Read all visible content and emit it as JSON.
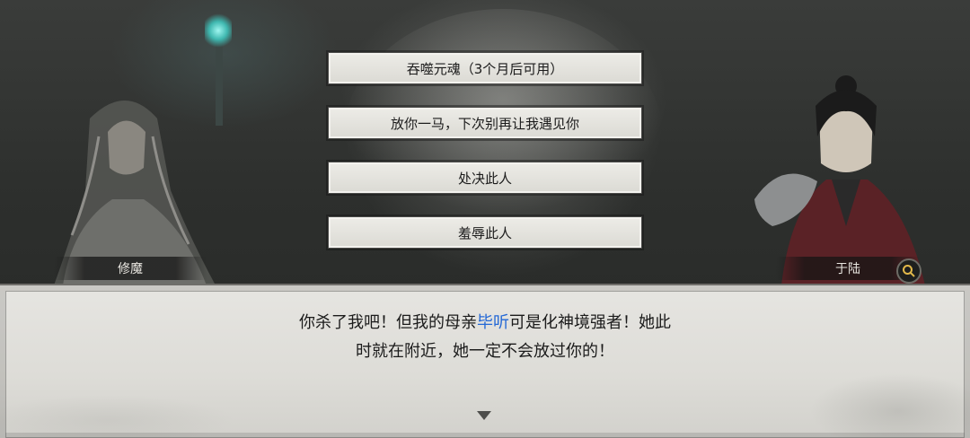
{
  "choices": [
    "吞噬元魂（3个月后可用）",
    "放你一马，下次别再让我遇见你",
    "处决此人",
    "羞辱此人"
  ],
  "left_character": {
    "name": "修魔"
  },
  "right_character": {
    "name": "于陆"
  },
  "dialog": {
    "line1_a": "你杀了我吧！但我的母亲",
    "line1_highlight": "毕听",
    "line1_b": "可是化神境强者！她此",
    "line2": "时就在附近，她一定不会放过你的！"
  },
  "colors": {
    "highlight": "#2468d6",
    "lantern": "#3fb8b0"
  },
  "icons": {
    "search": "search-icon",
    "advance": "triangle-down-icon"
  }
}
